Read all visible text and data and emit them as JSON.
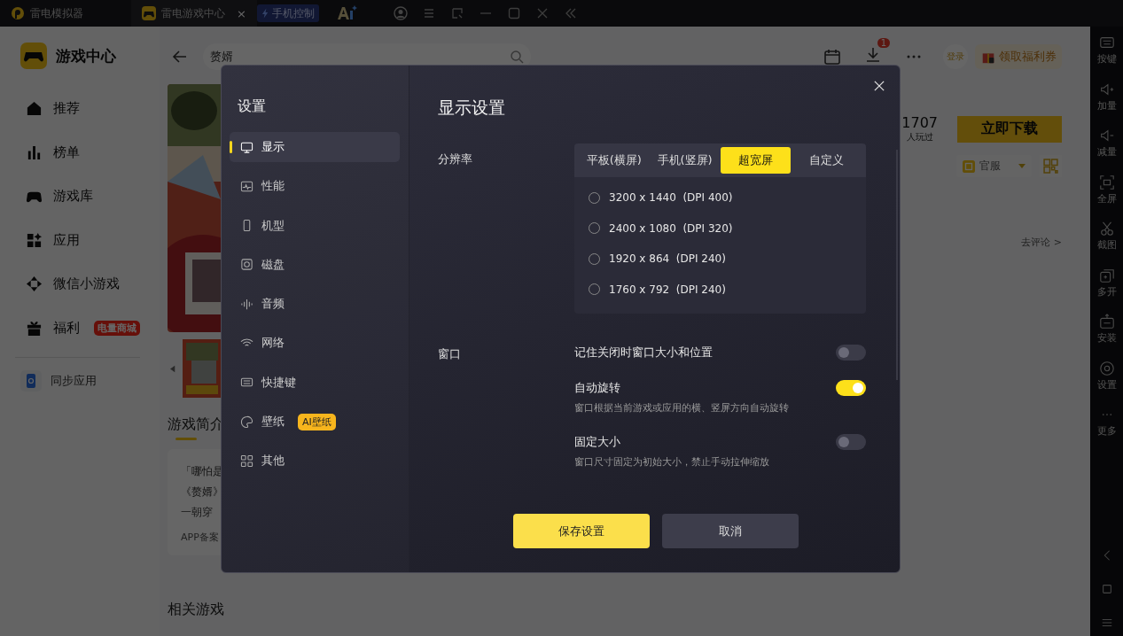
{
  "title_bar": {
    "tabs": [
      {
        "label": "雷电模拟器",
        "selected": false
      },
      {
        "label": "雷电游戏中心",
        "selected": true
      }
    ],
    "close_tab": "×",
    "phone_control": "手机控制"
  },
  "sidebar": {
    "brand": "游戏中心",
    "items": [
      {
        "label": "推荐"
      },
      {
        "label": "榜单"
      },
      {
        "label": "游戏库"
      },
      {
        "label": "应用"
      },
      {
        "label": "微信小游戏"
      },
      {
        "label": "福利",
        "badge": "电量商城"
      }
    ],
    "sync": "同步应用"
  },
  "header": {
    "search_value": "赘婿",
    "download_badge": "1",
    "login": "登录",
    "coupon": "领取福利券"
  },
  "game": {
    "plays": "1707",
    "plays_label": "人玩过",
    "download": "立即下载",
    "server": "官服",
    "review": "去评论 >",
    "intro_heading": "游戏简介",
    "intro_lines": [
      "「哪怕是",
      "《赘婿》",
      "一朝穿"
    ],
    "filing": "APP备案",
    "related_heading": "相关游戏"
  },
  "toolbar": {
    "items": [
      {
        "label": "按键"
      },
      {
        "label": "加量"
      },
      {
        "label": "减量"
      },
      {
        "label": "全屏"
      },
      {
        "label": "截图"
      },
      {
        "label": "多开"
      },
      {
        "label": "安装"
      },
      {
        "label": "设置"
      },
      {
        "label": "更多"
      }
    ]
  },
  "dialog": {
    "title": "设置",
    "nav": [
      {
        "label": "显示",
        "selected": true
      },
      {
        "label": "性能",
        "selected": false
      },
      {
        "label": "机型",
        "selected": false
      },
      {
        "label": "磁盘",
        "selected": false
      },
      {
        "label": "音频",
        "selected": false
      },
      {
        "label": "网络",
        "selected": false
      },
      {
        "label": "快捷键",
        "selected": false
      },
      {
        "label": "壁纸",
        "selected": false,
        "badge": "AI壁纸"
      },
      {
        "label": "其他",
        "selected": false
      }
    ],
    "heading": "显示设置",
    "resolution_label": "分辨率",
    "resolution_tabs": [
      {
        "label": "平板(横屏)",
        "selected": false
      },
      {
        "label": "手机(竖屏)",
        "selected": false
      },
      {
        "label": "超宽屏",
        "selected": true
      },
      {
        "label": "自定义",
        "selected": false
      }
    ],
    "resolutions": [
      {
        "label": "3200 x 1440  (DPI 400)",
        "selected": false
      },
      {
        "label": "2400 x 1080  (DPI 320)",
        "selected": false
      },
      {
        "label": "1920 x 864  (DPI 240)",
        "selected": false
      },
      {
        "label": "1760 x 792  (DPI 240)",
        "selected": false
      }
    ],
    "window_label": "窗口",
    "toggles": [
      {
        "label": "记住关闭时窗口大小和位置",
        "on": false
      },
      {
        "label": "自动旋转",
        "description": "窗口根据当前游戏或应用的横、竖屏方向自动旋转",
        "on": true
      },
      {
        "label": "固定大小",
        "description": "窗口尺寸固定为初始大小，禁止手动拉伸缩放",
        "on": false
      }
    ],
    "save": "保存设置",
    "cancel": "取消"
  }
}
